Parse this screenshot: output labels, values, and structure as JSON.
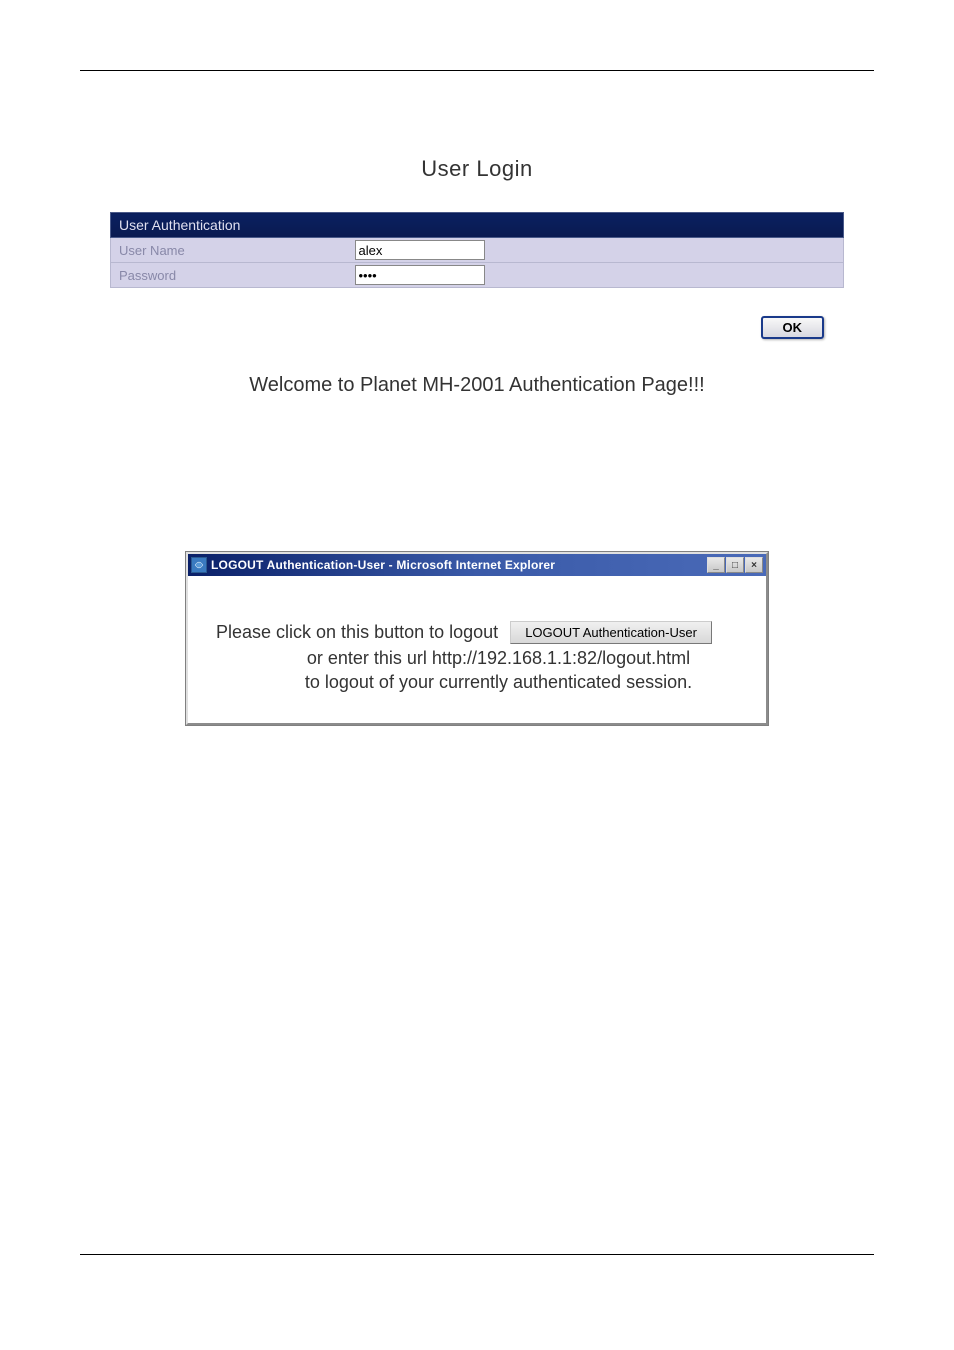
{
  "login": {
    "title": "User Login",
    "section_header": "User Authentication",
    "username_label": "User Name",
    "username_value": "alex",
    "password_label": "Password",
    "password_value": "••••",
    "ok_label": "OK",
    "welcome_message": "Welcome to Planet MH-2001 Authentication Page!!!"
  },
  "logout_window": {
    "titlebar_text": "LOGOUT Authentication-User - Microsoft Internet Explorer",
    "line1": "Please click on this button to logout",
    "button_label": "LOGOUT Authentication-User",
    "line2": "or enter this url http://192.168.1.1:82/logout.html",
    "line3": "to logout of your currently authenticated session."
  }
}
